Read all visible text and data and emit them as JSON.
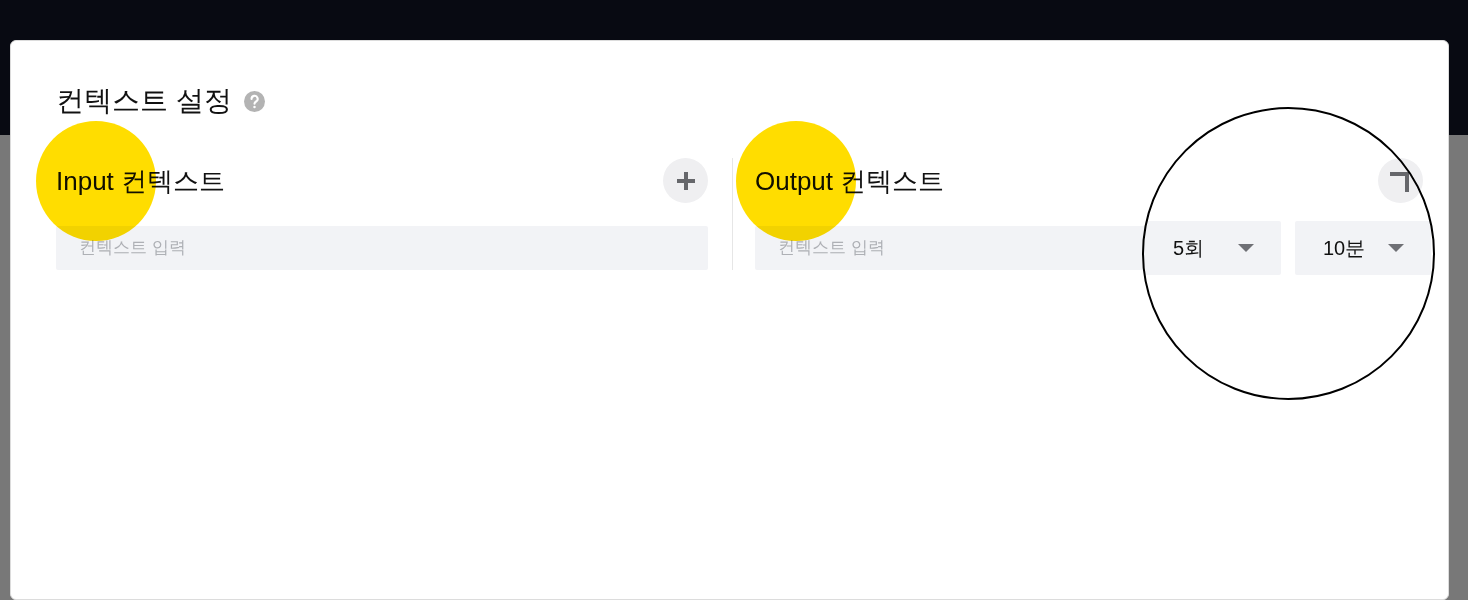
{
  "dialog": {
    "title": "컨텍스트 설정"
  },
  "input_context": {
    "title": "Input 컨텍스트",
    "highlighted": true,
    "field": {
      "placeholder": "컨텍스트 입력"
    }
  },
  "output_context": {
    "title": "Output 컨텍스트",
    "highlighted": true,
    "field": {
      "placeholder": "컨텍스트 입력"
    },
    "options_circled": true,
    "selects": [
      {
        "value": "5회"
      },
      {
        "value": "10분"
      }
    ]
  }
}
